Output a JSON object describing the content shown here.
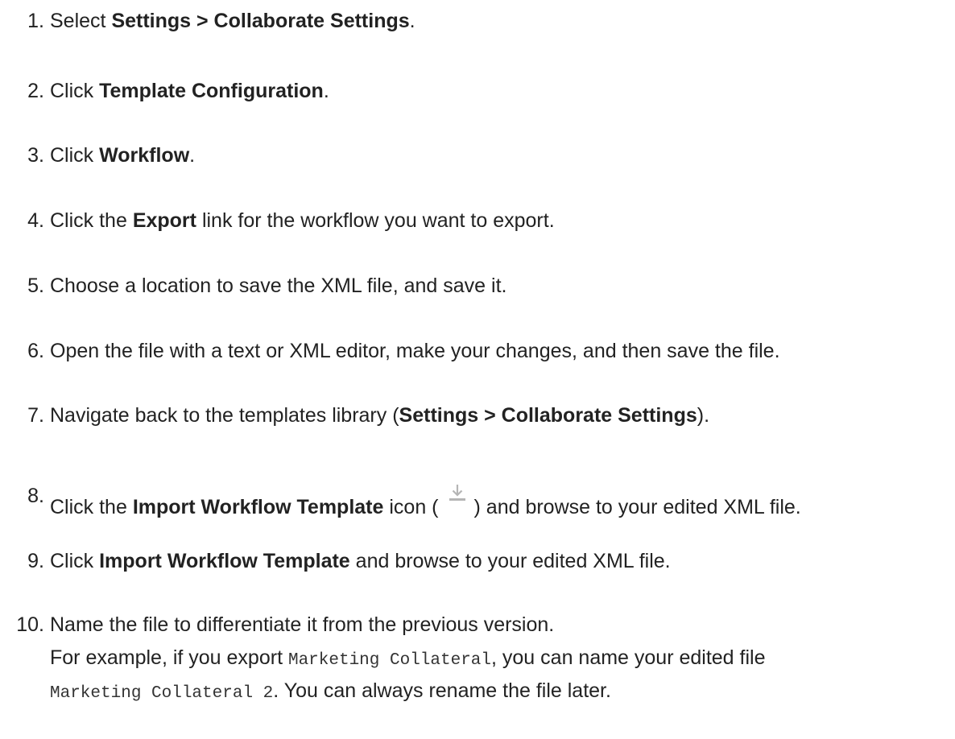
{
  "steps": [
    {
      "num": "1.",
      "pre": "Select ",
      "bold": "Settings > Collaborate Settings",
      "post": "."
    },
    {
      "num": "2.",
      "pre": "Click ",
      "bold": "Template Configuration",
      "post": "."
    },
    {
      "num": "3.",
      "pre": "Click ",
      "bold": "Workflow",
      "post": "."
    },
    {
      "num": "4.",
      "pre": "Click the ",
      "bold": "Export",
      "post": " link for the workflow you want to export."
    },
    {
      "num": "5.",
      "text": "Choose a location to save the XML file, and save it."
    },
    {
      "num": "6.",
      "text": "Open the file with a text or XML editor, make your changes, and then save the file."
    },
    {
      "num": "7.",
      "pre": "Navigate back to the templates library (",
      "bold": "Settings > Collaborate Settings",
      "post": ")."
    },
    {
      "num": "8.",
      "pre": "Click the ",
      "bold": "Import Workflow Template",
      "mid": " icon (",
      "post": ") and browse to your edited XML file.",
      "icon": "import-download-icon"
    },
    {
      "num": "9.",
      "pre": "Click ",
      "bold": "Import Workflow Template",
      "post": " and browse to your edited XML file."
    },
    {
      "num": "10.",
      "line1": "Name the file to differentiate it from the previous version.",
      "line2_pre": "For example, if you export ",
      "line2_code": "Marketing Collateral",
      "line2_post": ", you can name your edited file",
      "line3_code": "Marketing Collateral 2",
      "line3_post": ". You can always rename the file later."
    }
  ],
  "colors": {
    "text": "#222222",
    "icon": "#b5b5b5"
  }
}
